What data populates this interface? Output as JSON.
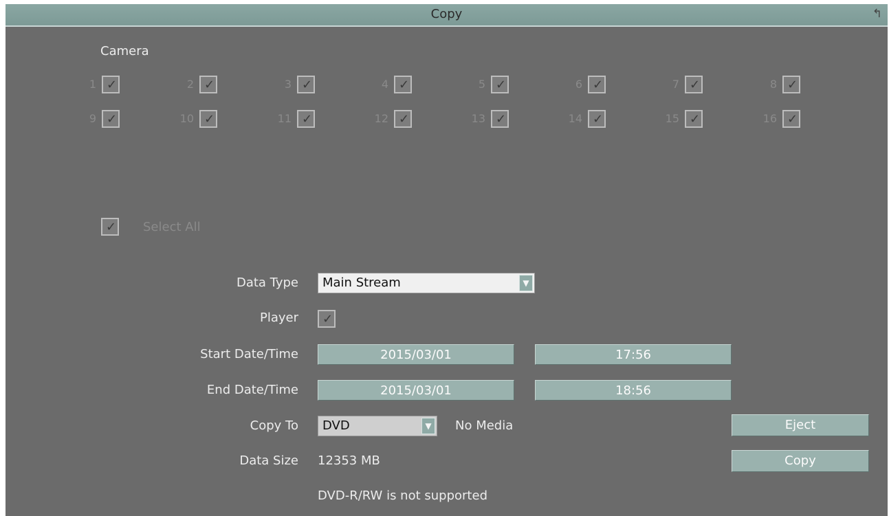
{
  "window": {
    "title": "Copy"
  },
  "camera": {
    "label": "Camera",
    "items": [
      {
        "num": "1",
        "checked": true
      },
      {
        "num": "2",
        "checked": true
      },
      {
        "num": "3",
        "checked": true
      },
      {
        "num": "4",
        "checked": true
      },
      {
        "num": "5",
        "checked": true
      },
      {
        "num": "6",
        "checked": true
      },
      {
        "num": "7",
        "checked": true
      },
      {
        "num": "8",
        "checked": true
      },
      {
        "num": "9",
        "checked": true
      },
      {
        "num": "10",
        "checked": true
      },
      {
        "num": "11",
        "checked": true
      },
      {
        "num": "12",
        "checked": true
      },
      {
        "num": "13",
        "checked": true
      },
      {
        "num": "14",
        "checked": true
      },
      {
        "num": "15",
        "checked": true
      },
      {
        "num": "16",
        "checked": true
      }
    ]
  },
  "select_all": {
    "label": "Select All",
    "checked": true
  },
  "form": {
    "data_type": {
      "label": "Data Type",
      "value": "Main Stream"
    },
    "player": {
      "label": "Player",
      "checked": true
    },
    "start": {
      "label": "Start Date/Time",
      "date": "2015/03/01",
      "time": "17:56"
    },
    "end": {
      "label": "End Date/Time",
      "date": "2015/03/01",
      "time": "18:56"
    },
    "copy_to": {
      "label": "Copy To",
      "value": "DVD",
      "media_status": "No Media"
    },
    "data_size": {
      "label": "Data Size",
      "value": "12353 MB"
    },
    "message": "DVD-R/RW is not supported"
  },
  "buttons": {
    "eject": "Eject",
    "copy": "Copy"
  }
}
